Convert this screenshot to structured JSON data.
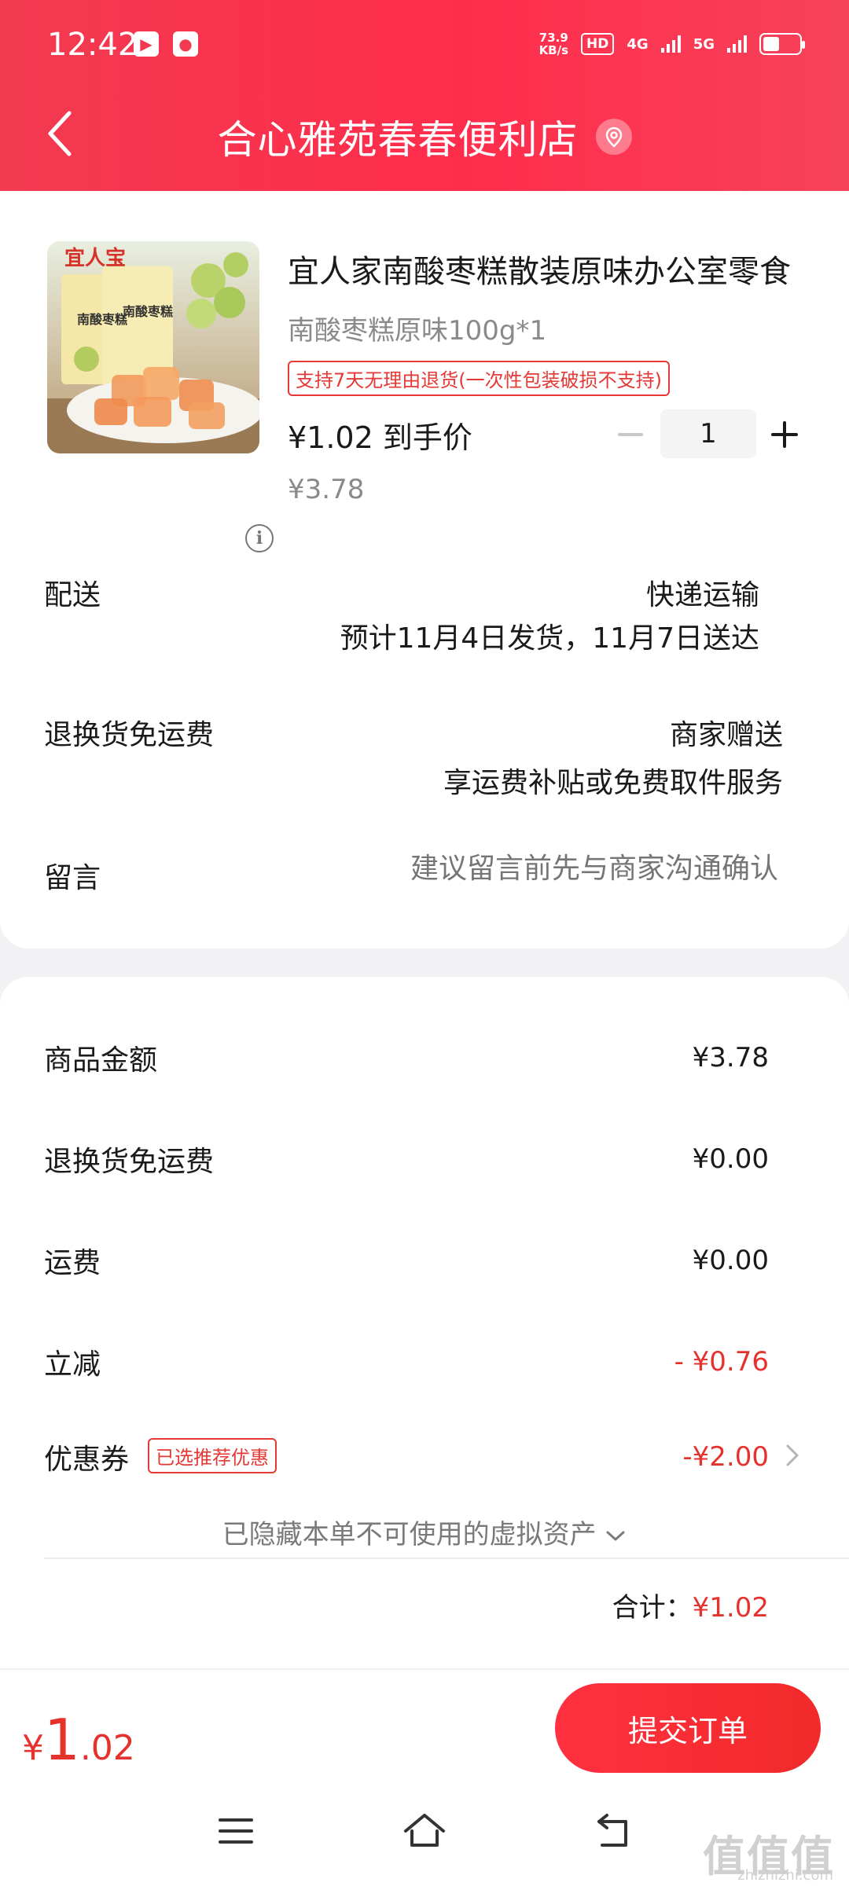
{
  "status_bar": {
    "time": "12:42",
    "net_speed_value": "73.9",
    "net_speed_unit": "KB/s",
    "hd_label": "HD",
    "sim1_label": "4G",
    "sim2_label": "5G"
  },
  "header": {
    "store_name": "合心雅苑春春便利店",
    "icons": [
      "back-arrow-icon",
      "location-pin-icon"
    ]
  },
  "product": {
    "title": "宜人家南酸枣糕散装原味办公室零食",
    "spec": "南酸枣糕原味100g*1",
    "return_tag": "支持7天无理由退货(一次性包装破损不支持)",
    "price_label": "¥1.02 到手价",
    "original_price": "¥3.78",
    "quantity": "1",
    "image_brand_text": "宜人宝",
    "image_product_text": "南酸枣糕"
  },
  "delivery": {
    "label": "配送",
    "method": "快递运输",
    "estimate": "预计11月4日发货，11月7日送达"
  },
  "return_shipping": {
    "label": "退换货免运费",
    "value": "商家赠送",
    "detail": "享运费补贴或免费取件服务"
  },
  "message": {
    "label": "留言",
    "placeholder": "建议留言前先与商家沟通确认"
  },
  "summary": {
    "items": [
      {
        "label": "商品金额",
        "value": "¥3.78"
      },
      {
        "label": "退换货免运费",
        "value": "¥0.00"
      },
      {
        "label": "运费",
        "value": "¥0.00"
      },
      {
        "label": "立减",
        "value": "- ¥0.76"
      }
    ],
    "coupon_label": "优惠券",
    "coupon_tag": "已选推荐优惠",
    "coupon_value": "-¥2.00",
    "hidden_assets": "已隐藏本单不可使用的虚拟资产",
    "total_label": "合计：",
    "total_value": "¥1.02"
  },
  "bottom": {
    "price_symbol": "¥",
    "price_int": "1",
    "price_dec": ".02",
    "submit_label": "提交订单"
  },
  "watermark": {
    "text": "值值值",
    "sub": "zhizhizhi.com"
  },
  "colors": {
    "brand_red": "#f23a51",
    "price_red": "#e5322d",
    "muted_gray": "#8a8a8a"
  }
}
